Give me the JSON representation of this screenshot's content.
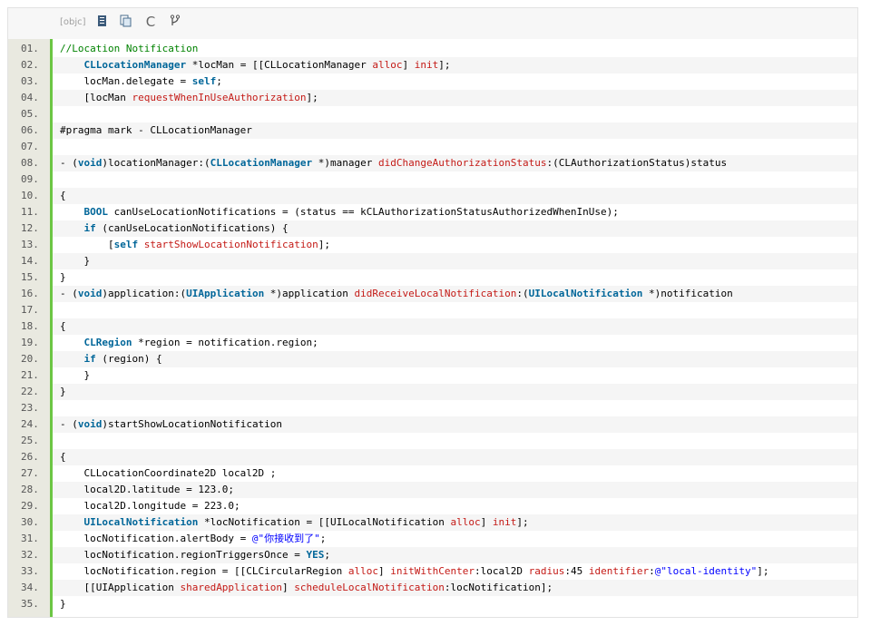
{
  "toolbar": {
    "language_label": "[objc]",
    "icons": [
      "view-source-icon",
      "copy-icon",
      "code-icon",
      "fork-icon"
    ]
  },
  "lines": [
    {
      "n": "01.",
      "segs": [
        {
          "c": "c",
          "t": "//Location Notification"
        }
      ]
    },
    {
      "n": "02.",
      "segs": [
        {
          "t": "    "
        },
        {
          "c": "t",
          "t": "CLLocationManager"
        },
        {
          "t": " *locMan = [[CLLocationManager "
        },
        {
          "c": "m",
          "t": "alloc"
        },
        {
          "t": "] "
        },
        {
          "c": "m",
          "t": "init"
        },
        {
          "t": "];"
        }
      ]
    },
    {
      "n": "03.",
      "segs": [
        {
          "t": "    locMan.delegate = "
        },
        {
          "c": "k",
          "t": "self"
        },
        {
          "t": ";"
        }
      ]
    },
    {
      "n": "04.",
      "segs": [
        {
          "t": "    [locMan "
        },
        {
          "c": "m",
          "t": "requestWhenInUseAuthorization"
        },
        {
          "t": "];"
        }
      ]
    },
    {
      "n": "05.",
      "segs": []
    },
    {
      "n": "06.",
      "segs": [
        {
          "t": "#pragma mark - CLLocationManager"
        }
      ]
    },
    {
      "n": "07.",
      "segs": []
    },
    {
      "n": "08.",
      "segs": [
        {
          "t": "- ("
        },
        {
          "c": "k",
          "t": "void"
        },
        {
          "t": ")locationManager:("
        },
        {
          "c": "t",
          "t": "CLLocationManager"
        },
        {
          "t": " *)manager "
        },
        {
          "c": "m",
          "t": "didChangeAuthorizationStatus"
        },
        {
          "t": ":(CLAuthorizationStatus)status"
        }
      ]
    },
    {
      "n": "09.",
      "segs": []
    },
    {
      "n": "10.",
      "segs": [
        {
          "t": "{"
        }
      ]
    },
    {
      "n": "11.",
      "segs": [
        {
          "t": "    "
        },
        {
          "c": "k",
          "t": "BOOL"
        },
        {
          "t": " canUseLocationNotifications = (status == kCLAuthorizationStatusAuthorizedWhenInUse);"
        }
      ]
    },
    {
      "n": "12.",
      "segs": [
        {
          "t": "    "
        },
        {
          "c": "k",
          "t": "if"
        },
        {
          "t": " (canUseLocationNotifications) {"
        }
      ]
    },
    {
      "n": "13.",
      "segs": [
        {
          "t": "        ["
        },
        {
          "c": "k",
          "t": "self"
        },
        {
          "t": " "
        },
        {
          "c": "m",
          "t": "startShowLocationNotification"
        },
        {
          "t": "];"
        }
      ]
    },
    {
      "n": "14.",
      "segs": [
        {
          "t": "    }"
        }
      ]
    },
    {
      "n": "15.",
      "segs": [
        {
          "t": "}"
        }
      ]
    },
    {
      "n": "16.",
      "segs": [
        {
          "t": "- ("
        },
        {
          "c": "k",
          "t": "void"
        },
        {
          "t": ")application:("
        },
        {
          "c": "t",
          "t": "UIApplication"
        },
        {
          "t": " *)application "
        },
        {
          "c": "m",
          "t": "didReceiveLocalNotification"
        },
        {
          "t": ":("
        },
        {
          "c": "t",
          "t": "UILocalNotification"
        },
        {
          "t": " *)notification"
        }
      ]
    },
    {
      "n": "17.",
      "segs": []
    },
    {
      "n": "18.",
      "segs": [
        {
          "t": "{"
        }
      ]
    },
    {
      "n": "19.",
      "segs": [
        {
          "t": "    "
        },
        {
          "c": "t",
          "t": "CLRegion"
        },
        {
          "t": " *region = notification.region;"
        }
      ]
    },
    {
      "n": "20.",
      "segs": [
        {
          "t": "    "
        },
        {
          "c": "k",
          "t": "if"
        },
        {
          "t": " (region) {"
        }
      ]
    },
    {
      "n": "21.",
      "segs": [
        {
          "t": "    }"
        }
      ]
    },
    {
      "n": "22.",
      "segs": [
        {
          "t": "}"
        }
      ]
    },
    {
      "n": "23.",
      "segs": []
    },
    {
      "n": "24.",
      "segs": [
        {
          "t": "- ("
        },
        {
          "c": "k",
          "t": "void"
        },
        {
          "t": ")startShowLocationNotification"
        }
      ]
    },
    {
      "n": "25.",
      "segs": []
    },
    {
      "n": "26.",
      "segs": [
        {
          "t": "{"
        }
      ]
    },
    {
      "n": "27.",
      "segs": [
        {
          "t": "    CLLocationCoordinate2D local2D ;"
        }
      ]
    },
    {
      "n": "28.",
      "segs": [
        {
          "t": "    local2D.latitude = 123.0;"
        }
      ]
    },
    {
      "n": "29.",
      "segs": [
        {
          "t": "    local2D.longitude = 223.0;"
        }
      ]
    },
    {
      "n": "30.",
      "segs": [
        {
          "t": "    "
        },
        {
          "c": "t",
          "t": "UILocalNotification"
        },
        {
          "t": " *locNotification = [[UILocalNotification "
        },
        {
          "c": "m",
          "t": "alloc"
        },
        {
          "t": "] "
        },
        {
          "c": "m",
          "t": "init"
        },
        {
          "t": "];"
        }
      ]
    },
    {
      "n": "31.",
      "segs": [
        {
          "t": "    locNotification.alertBody = "
        },
        {
          "c": "s",
          "t": "@\"你接收到了\""
        },
        {
          "t": ";"
        }
      ]
    },
    {
      "n": "32.",
      "segs": [
        {
          "t": "    locNotification.regionTriggersOnce = "
        },
        {
          "c": "k",
          "t": "YES"
        },
        {
          "t": ";"
        }
      ]
    },
    {
      "n": "33.",
      "segs": [
        {
          "t": "    locNotification.region = [[CLCircularRegion "
        },
        {
          "c": "m",
          "t": "alloc"
        },
        {
          "t": "] "
        },
        {
          "c": "m",
          "t": "initWithCenter"
        },
        {
          "t": ":local2D "
        },
        {
          "c": "m",
          "t": "radius"
        },
        {
          "t": ":45 "
        },
        {
          "c": "m",
          "t": "identifier"
        },
        {
          "t": ":"
        },
        {
          "c": "s",
          "t": "@\"local-identity\""
        },
        {
          "t": "];"
        }
      ]
    },
    {
      "n": "34.",
      "segs": [
        {
          "t": "    [[UIApplication "
        },
        {
          "c": "m",
          "t": "sharedApplication"
        },
        {
          "t": "] "
        },
        {
          "c": "m",
          "t": "scheduleLocalNotification"
        },
        {
          "t": ":locNotification];"
        }
      ]
    },
    {
      "n": "35.",
      "segs": [
        {
          "t": "}"
        }
      ]
    }
  ]
}
